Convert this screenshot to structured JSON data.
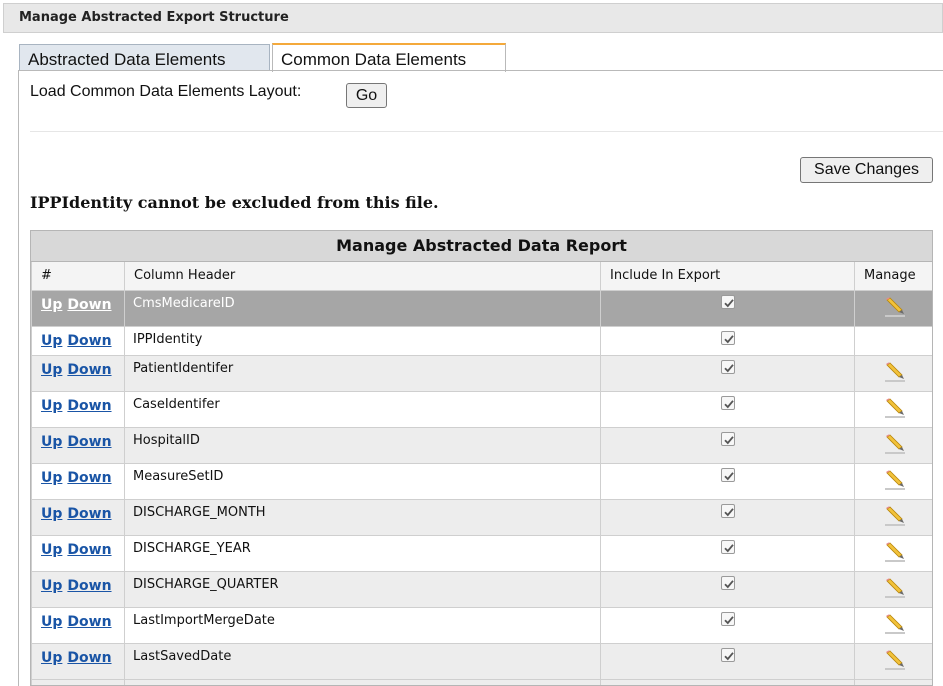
{
  "window": {
    "title": "Manage Abstracted Export Structure"
  },
  "tabs": [
    {
      "label": "Abstracted Data Elements"
    },
    {
      "label": "Common Data Elements"
    }
  ],
  "load_layout": {
    "label": "Load Common Data Elements Layout:",
    "go_label": "Go"
  },
  "save_label": "Save Changes",
  "note": "IPPIdentity cannot be excluded from this file.",
  "grid": {
    "title": "Manage Abstracted Data Report",
    "headers": [
      "#",
      "Column Header",
      "Include In Export",
      "Manage"
    ],
    "up_label": "Up",
    "down_label": "Down",
    "rows": [
      {
        "name": "CmsMedicareID",
        "include": true,
        "manage_icon": "pencil-icon",
        "selected": true
      },
      {
        "name": "IPPIdentity",
        "include": true,
        "manage_icon": ""
      },
      {
        "name": "PatientIdentifer",
        "include": true,
        "manage_icon": "pencil-icon"
      },
      {
        "name": "CaseIdentifer",
        "include": true,
        "manage_icon": "pencil-icon"
      },
      {
        "name": "HospitalID",
        "include": true,
        "manage_icon": "pencil-icon"
      },
      {
        "name": "MeasureSetID",
        "include": true,
        "manage_icon": "pencil-icon"
      },
      {
        "name": "DISCHARGE_MONTH",
        "include": true,
        "manage_icon": "pencil-icon"
      },
      {
        "name": "DISCHARGE_YEAR",
        "include": true,
        "manage_icon": "pencil-icon"
      },
      {
        "name": "DISCHARGE_QUARTER",
        "include": true,
        "manage_icon": "pencil-icon"
      },
      {
        "name": "LastImportMergeDate",
        "include": true,
        "manage_icon": "pencil-icon"
      },
      {
        "name": "LastSavedDate",
        "include": true,
        "manage_icon": "pencil-icon"
      }
    ]
  },
  "colors": {
    "tab_accent": "#f4a93b",
    "link": "#1a55a6",
    "selected_row": "#a6a6a6"
  }
}
